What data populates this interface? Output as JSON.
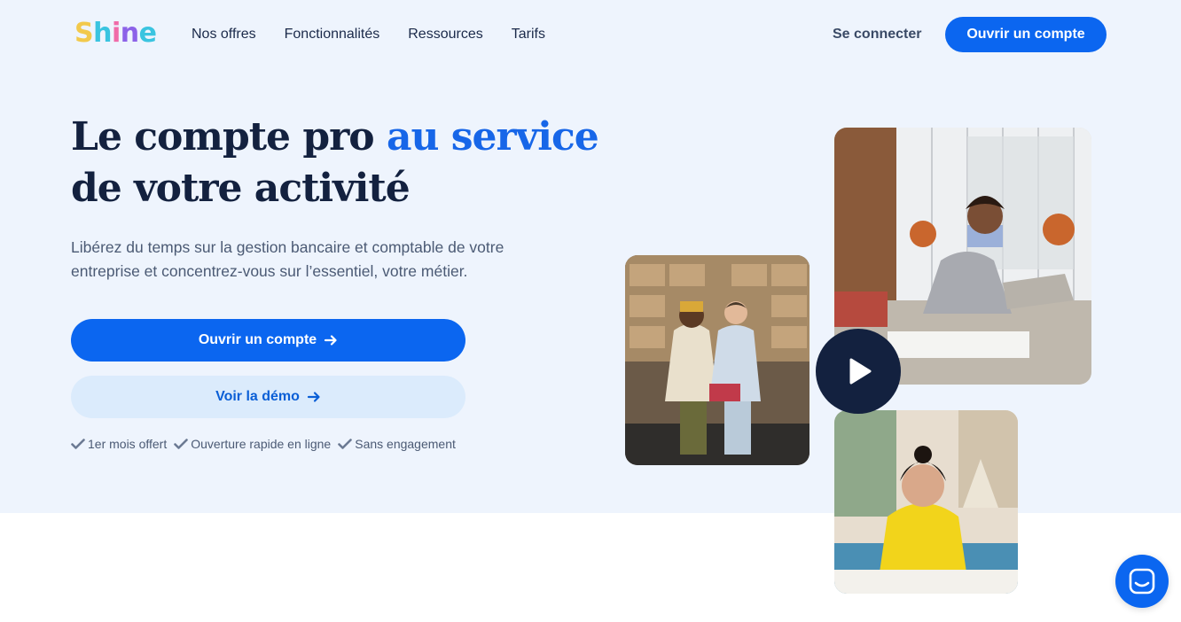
{
  "brand": {
    "letters": [
      {
        "char": "S",
        "color": "#f2c94c"
      },
      {
        "char": "h",
        "color": "#3ac4e0"
      },
      {
        "char": "i",
        "color": "#f06aa8"
      },
      {
        "char": "n",
        "color": "#8c62e8"
      },
      {
        "char": "e",
        "color": "#3ac4e0"
      }
    ]
  },
  "nav": {
    "items": [
      {
        "label": "Nos offres"
      },
      {
        "label": "Fonctionnalités"
      },
      {
        "label": "Ressources"
      },
      {
        "label": "Tarifs"
      }
    ],
    "login_label": "Se connecter",
    "cta_label": "Ouvrir un compte"
  },
  "hero": {
    "title_part1": "Le compte pro ",
    "title_accent": "au service",
    "title_part2": "de votre activité",
    "subtitle": "Libérez du temps sur la gestion bancaire et comptable de votre entreprise et concentrez-vous sur l’essentiel, votre métier.",
    "primary_cta": "Ouvrir un compte",
    "secondary_cta": "Voir la démo",
    "perks": [
      {
        "label": "1er mois offert"
      },
      {
        "label": "Ouverture rapide en ligne"
      },
      {
        "label": "Sans engagement"
      }
    ]
  },
  "colors": {
    "primary": "#0b66f0",
    "accent_text": "#1766e8",
    "navy": "#13213f",
    "hero_bg": "#eef4fd",
    "secondary_bg": "#dbebfc"
  },
  "icons": {
    "play": "play-icon",
    "chat": "chat-icon",
    "arrow": "arrow-right-icon",
    "check": "check-icon"
  }
}
